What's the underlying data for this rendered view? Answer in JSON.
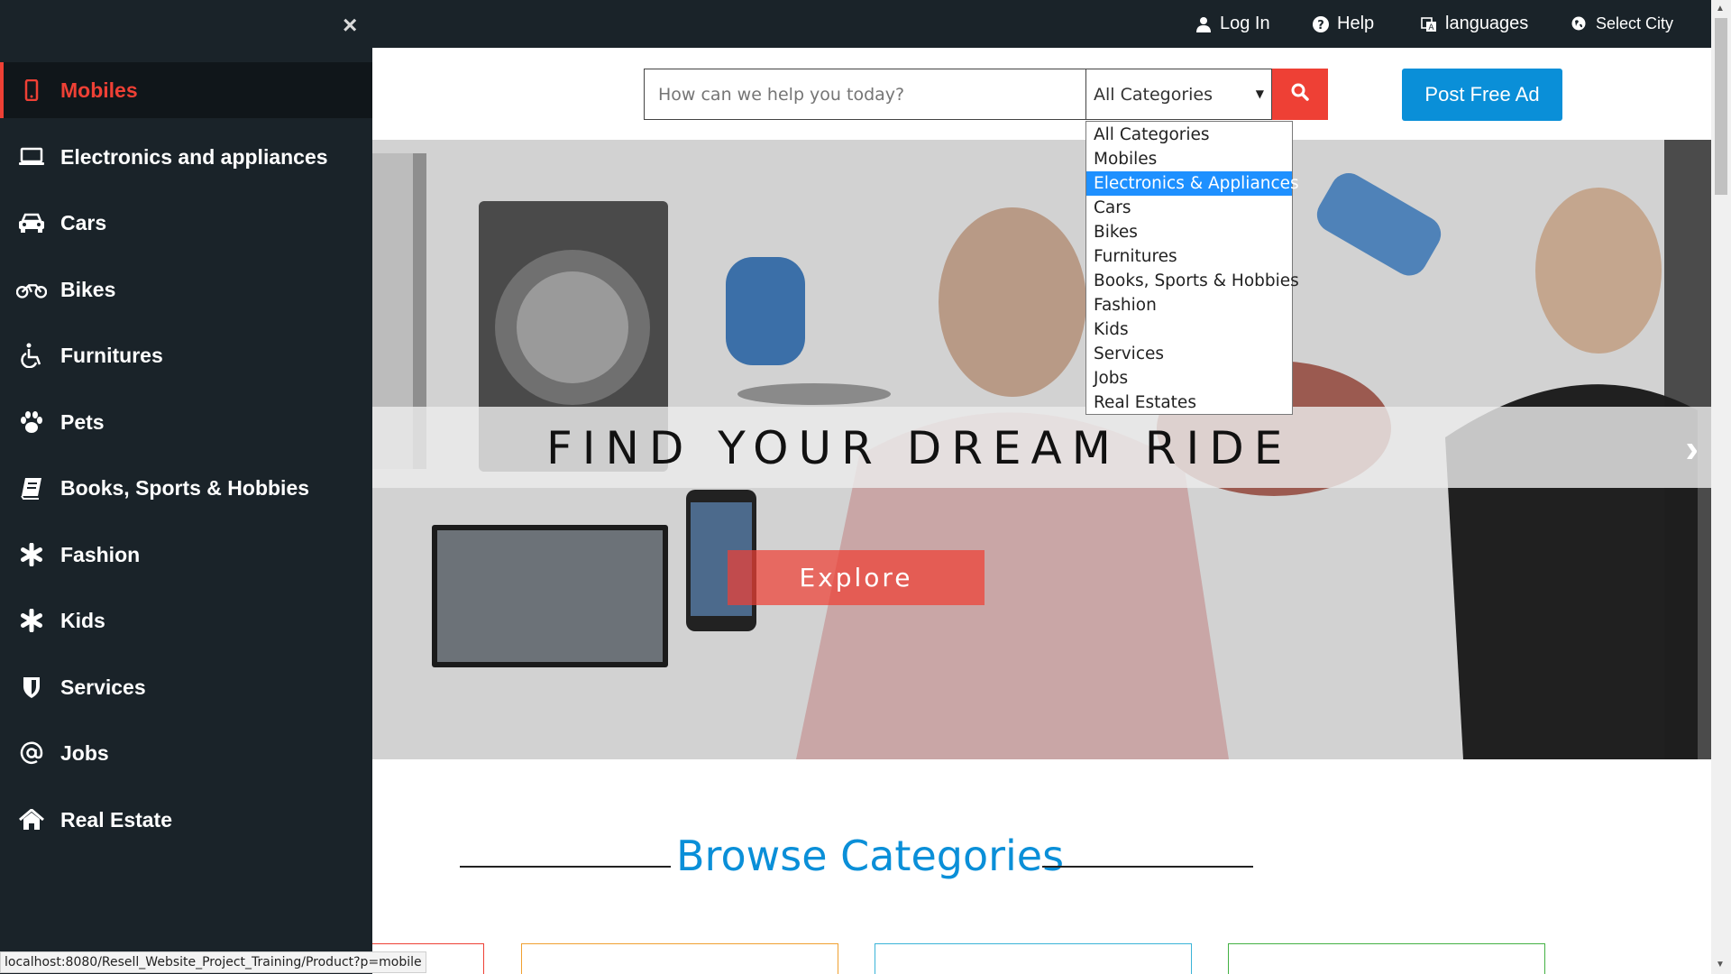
{
  "topbar": {
    "login_label": "Log In",
    "help_label": "Help",
    "languages_label": "languages",
    "city_label": "Select City"
  },
  "search": {
    "placeholder": "How can we help you today?",
    "category_selected": "All Categories",
    "category_options": [
      "All Categories",
      "Mobiles",
      "Electronics & Appliances",
      "Cars",
      "Bikes",
      "Furnitures",
      "Books, Sports & Hobbies",
      "Fashion",
      "Kids",
      "Services",
      "Jobs",
      "Real Estates"
    ],
    "highlighted_option": "Electronics & Appliances"
  },
  "post_ad_label": "Post Free Ad",
  "hero": {
    "title": "FIND YOUR DREAM RIDE",
    "button_label": "Explore"
  },
  "browse": {
    "title": "Browse Categories",
    "card_border_colors": [
      "#ee4035",
      "#f0a030",
      "#3ab4d8",
      "#43b143"
    ]
  },
  "sidebar": {
    "close_symbol": "×",
    "items": [
      {
        "label": "Mobiles",
        "icon": "mobile-icon"
      },
      {
        "label": "Electronics and appliances",
        "icon": "laptop-icon"
      },
      {
        "label": "Cars",
        "icon": "car-icon"
      },
      {
        "label": "Bikes",
        "icon": "motorcycle-icon"
      },
      {
        "label": "Furnitures",
        "icon": "wheelchair-icon"
      },
      {
        "label": "Pets",
        "icon": "paw-icon"
      },
      {
        "label": "Books, Sports & Hobbies",
        "icon": "book-icon"
      },
      {
        "label": "Fashion",
        "icon": "asterisk-icon"
      },
      {
        "label": "Kids",
        "icon": "asterisk-icon"
      },
      {
        "label": "Services",
        "icon": "shield-icon"
      },
      {
        "label": "Jobs",
        "icon": "at-icon"
      },
      {
        "label": "Real Estate",
        "icon": "home-icon"
      }
    ]
  },
  "status_url": "localhost:8080/Resell_Website_Project_Training/Product?p=mobile",
  "colors": {
    "dark_bg": "#1a2329",
    "accent_red": "#ee4035",
    "accent_blue": "#0a8fd8",
    "dropdown_highlight": "#1e90ff"
  }
}
